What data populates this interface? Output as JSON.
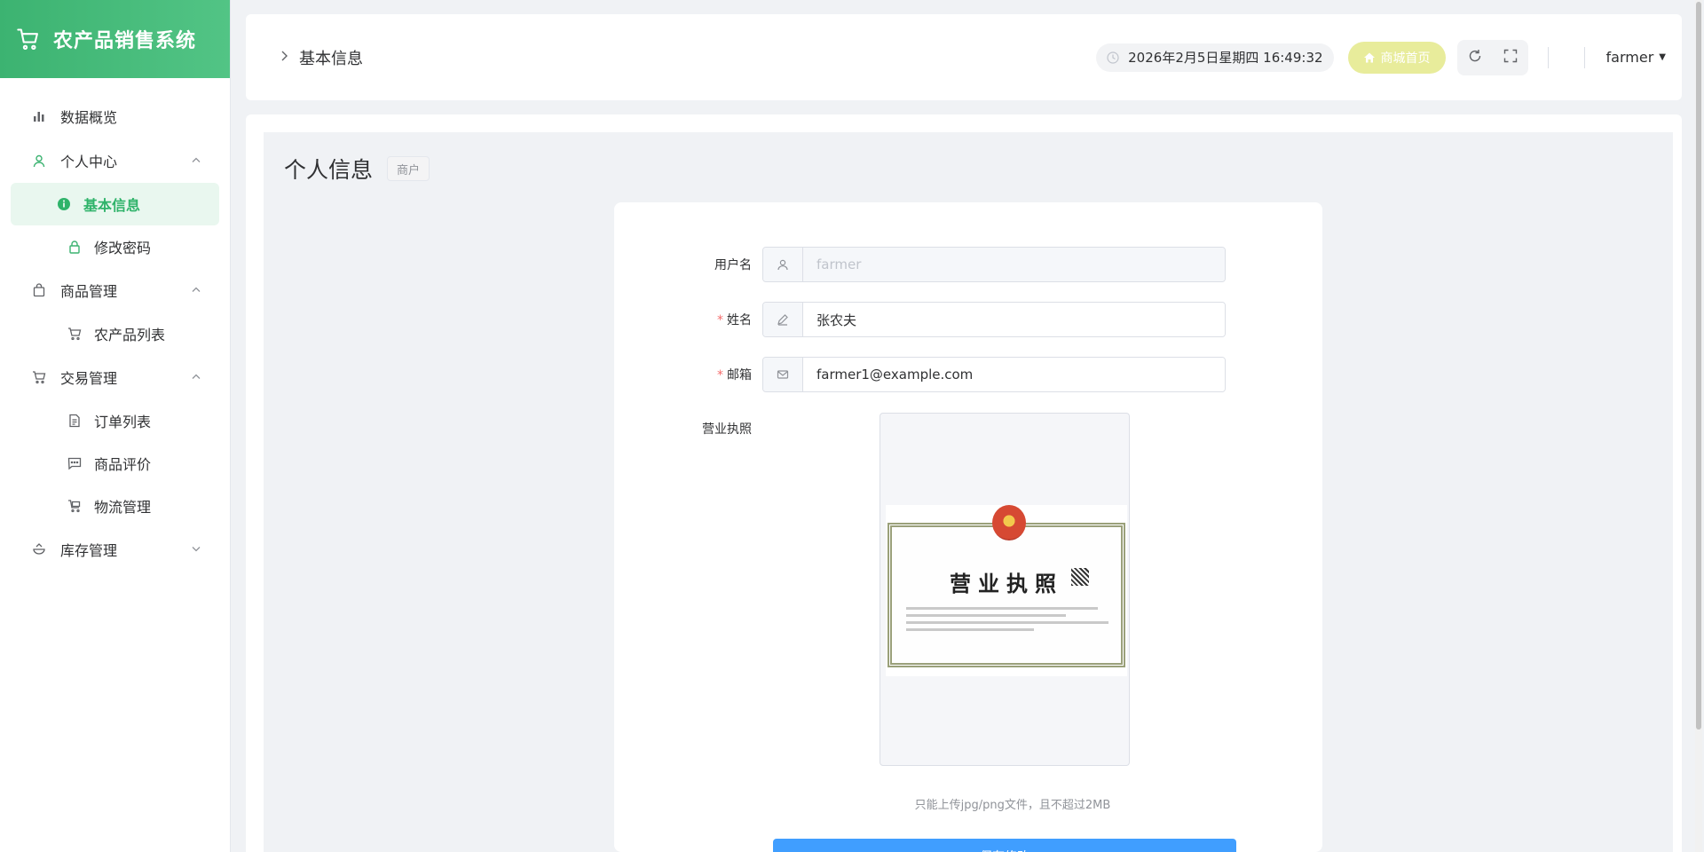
{
  "brand": {
    "title": "农产品销售系统"
  },
  "sidebar": {
    "items": [
      {
        "label": "数据概览"
      },
      {
        "label": "个人中心",
        "children": [
          {
            "label": "基本信息"
          },
          {
            "label": "修改密码"
          }
        ]
      },
      {
        "label": "商品管理",
        "children": [
          {
            "label": "农产品列表"
          }
        ]
      },
      {
        "label": "交易管理",
        "children": [
          {
            "label": "订单列表"
          },
          {
            "label": "商品评价"
          },
          {
            "label": "物流管理"
          }
        ]
      },
      {
        "label": "库存管理"
      }
    ]
  },
  "header": {
    "breadcrumb": "基本信息",
    "datetime": "2026年2月5日星期四 16:49:32",
    "mall_button": "商城首页",
    "username": "farmer"
  },
  "page": {
    "title": "个人信息",
    "role_tag": "商户"
  },
  "form": {
    "username_label": "用户名",
    "username_value": "farmer",
    "name_label": "姓名",
    "name_value": "张农夫",
    "email_label": "邮箱",
    "email_value": "farmer1@example.com",
    "license_label": "营业执照",
    "license_image_title": "营业执照",
    "upload_tip": "只能上传jpg/png文件，且不超过2MB",
    "submit_label": "保存修改",
    "required_mark": "*"
  },
  "colors": {
    "brand_green": "#3cb371",
    "active_green": "#2fb36a",
    "primary_blue": "#409eff",
    "mall_yellow": "#e8ec9b"
  }
}
